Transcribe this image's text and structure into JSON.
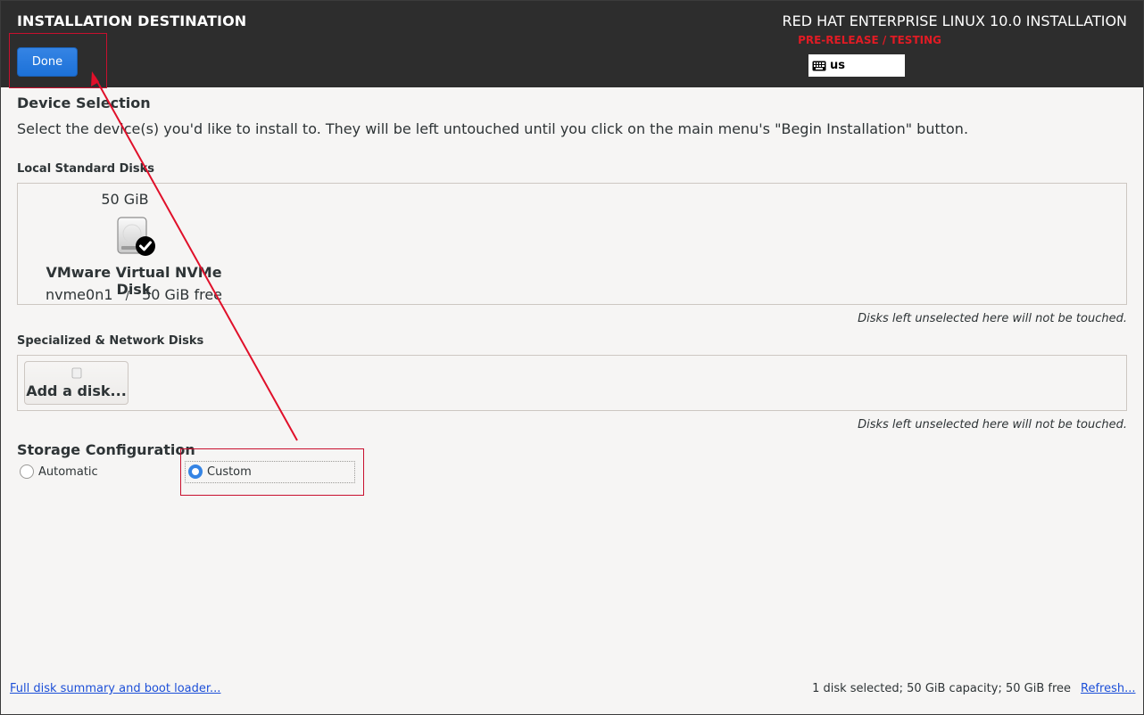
{
  "header": {
    "title": "INSTALLATION DESTINATION",
    "done_label": "Done",
    "product_title": "RED HAT ENTERPRISE LINUX 10.0 INSTALLATION",
    "prerelease": "PRE-RELEASE / TESTING",
    "keyboard_layout": "us"
  },
  "device_selection": {
    "heading": "Device Selection",
    "instruction": "Select the device(s) you'd like to install to.  They will be left untouched until you click on the main menu's \"Begin Installation\" button."
  },
  "local_disks": {
    "heading": "Local Standard Disks",
    "disks": [
      {
        "size": "50 GiB",
        "name": "VMware Virtual NVMe Disk",
        "device": "nvme0n1",
        "separator": "/",
        "free": "50 GiB free",
        "selected": true
      }
    ],
    "hint": "Disks left unselected here will not be touched."
  },
  "specialized_disks": {
    "heading": "Specialized & Network Disks",
    "add_label": "Add a disk...",
    "hint": "Disks left unselected here will not be touched."
  },
  "storage_configuration": {
    "heading": "Storage Configuration",
    "options": [
      {
        "label": "Automatic",
        "selected": false
      },
      {
        "label": "Custom",
        "selected": true
      }
    ]
  },
  "footer": {
    "summary_link": "Full disk summary and boot loader...",
    "status": "1 disk selected; 50 GiB capacity; 50 GiB free",
    "refresh_link": "Refresh..."
  },
  "colors": {
    "header_bg": "#2d2d2d",
    "accent": "#3584e4",
    "prerelease": "#e01b24",
    "annotation": "#c8102e"
  }
}
